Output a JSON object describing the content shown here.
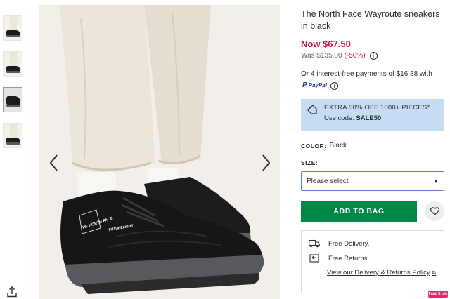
{
  "product": {
    "title": "The North Face Wayroute sneakers in black",
    "price_now": "Now $67.50",
    "price_was": "Was $135.00",
    "discount": "(-50%)"
  },
  "payments": {
    "text": "Or 4 interest-free payments of $16.88 with",
    "provider": "PayPal"
  },
  "promo": {
    "line1": "EXTRA 50% OFF 1000+ PIECES*",
    "code_label": "Use code:",
    "code": "SALE50"
  },
  "colour": {
    "label": "COLOR:",
    "value": "Black"
  },
  "size": {
    "label": "SIZE:",
    "selected": "Please select"
  },
  "actions": {
    "add_to_bag": "ADD TO BAG"
  },
  "delivery": {
    "free_delivery": "Free Delivery.",
    "free_returns": "Free Returns",
    "policy_link": "View our Delivery & Returns Policy"
  },
  "shoe_logo": {
    "brand": "THE NORTH FACE",
    "tech": "FUTURELIGHT"
  },
  "badge": "Paint X Idle",
  "colors": {
    "sale_red": "#d01345",
    "promo_blue": "#c5dcf3",
    "add_green": "#018849",
    "focus_blue": "#5b7fd6"
  },
  "icons": [
    "share-icon",
    "chevron-left-icon",
    "chevron-right-icon",
    "info-icon",
    "paypal-icon",
    "tag-icon",
    "chevron-down-icon",
    "heart-icon",
    "truck-icon",
    "returns-icon",
    "external-link-icon"
  ]
}
